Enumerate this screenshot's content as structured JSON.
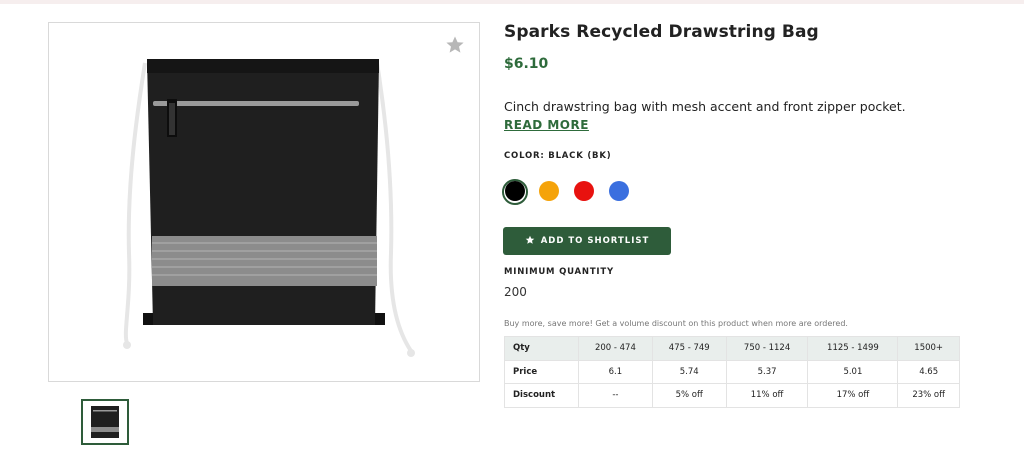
{
  "product": {
    "title": "Sparks Recycled Drawstring Bag",
    "price": "$6.10",
    "description": "Cinch drawstring bag with mesh accent and front zipper pocket.",
    "read_more": "READ MORE",
    "color_label": "COLOR: BLACK (BK)",
    "swatches": [
      {
        "name": "Black",
        "hex": "#000000",
        "selected": true
      },
      {
        "name": "Orange",
        "hex": "#f5a30a",
        "selected": false
      },
      {
        "name": "Red",
        "hex": "#e8120f",
        "selected": false
      },
      {
        "name": "Blue",
        "hex": "#3a6fdf",
        "selected": false
      }
    ],
    "shortlist_button": "ADD TO SHORTLIST",
    "min_qty_label": "MINIMUM QUANTITY",
    "min_qty_value": "200",
    "discount_note": "Buy more, save more! Get a volume discount on this product when more are ordered."
  },
  "volume_table": {
    "headers": [
      "Qty",
      "200 - 474",
      "475 - 749",
      "750 - 1124",
      "1125 - 1499",
      "1500+"
    ],
    "rows": [
      [
        "Price",
        "6.1",
        "5.74",
        "5.37",
        "5.01",
        "4.65"
      ],
      [
        "Discount",
        "--",
        "5% off",
        "11% off",
        "17% off",
        "23% off"
      ]
    ]
  },
  "colors": {
    "accent_green": "#2e5c3a",
    "price_green": "#2e6b3b",
    "table_header_bg": "#e9eeec"
  },
  "icons": {
    "favorite": "star-icon",
    "shortlist": "star-icon"
  }
}
